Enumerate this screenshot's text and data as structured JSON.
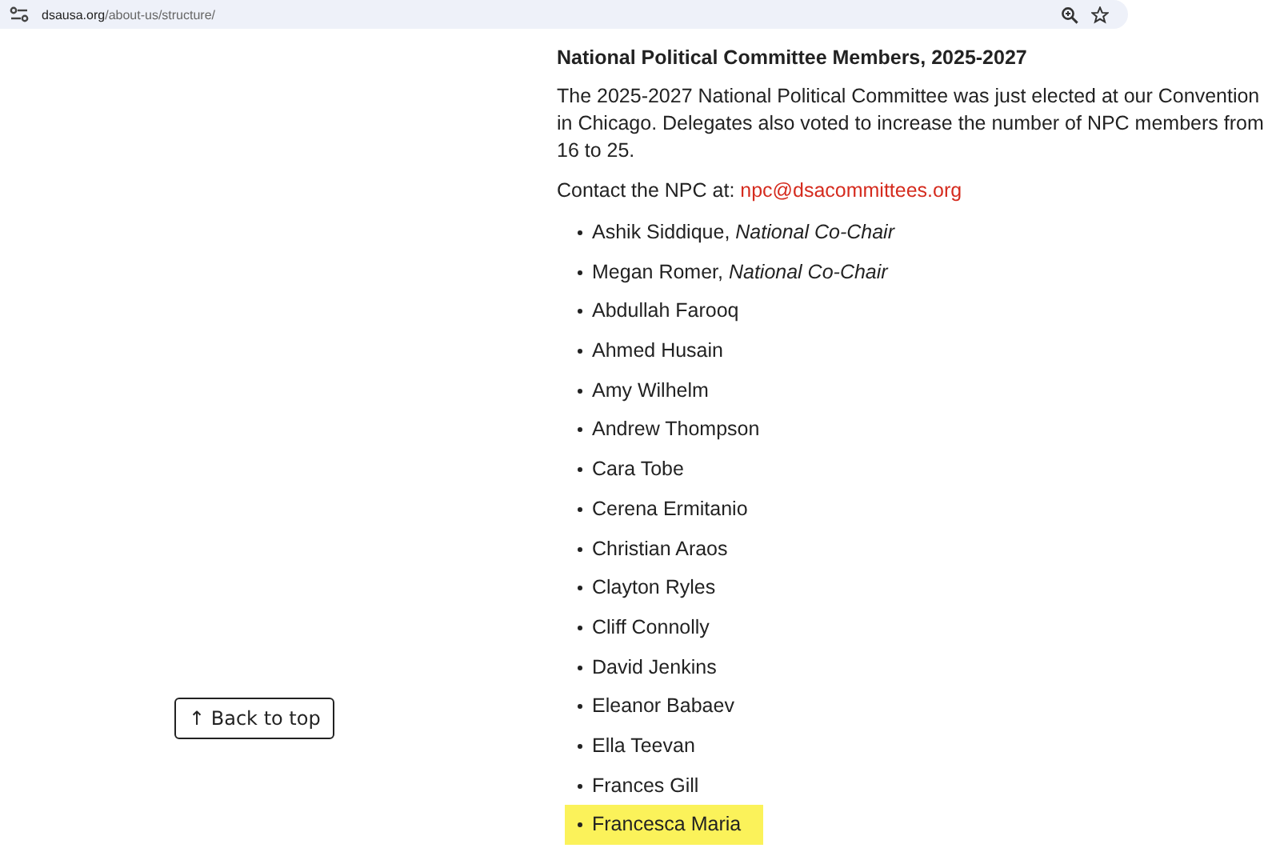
{
  "address_bar": {
    "domain": "dsausa.org",
    "path": "/about-us/structure/"
  },
  "back_to_top": {
    "arrow": "↑",
    "label": "Back to top"
  },
  "heading": "National Political Committee Members, 2025-2027",
  "intro": "The 2025-2027 National Political Committee was just elected at our Convention in Chicago. Delegates also voted to increase the number of NPC members from 16 to 25.",
  "contact": {
    "label": "Contact the NPC at:",
    "email": "npc@dsacommittees.org"
  },
  "members": [
    {
      "name": "Ashik Siddique, *National Co-Chair*",
      "highlighted": false
    },
    {
      "name": "Megan Romer, *National Co-Chair*",
      "highlighted": false
    },
    {
      "name": "Abdullah Farooq",
      "highlighted": false
    },
    {
      "name": "Ahmed Husain",
      "highlighted": false
    },
    {
      "name": "Amy Wilhelm",
      "highlighted": false
    },
    {
      "name": "Andrew Thompson",
      "highlighted": false
    },
    {
      "name": "Cara Tobe",
      "highlighted": false
    },
    {
      "name": "Cerena Ermitanio",
      "highlighted": false
    },
    {
      "name": "Christian Araos",
      "highlighted": false
    },
    {
      "name": "Clayton Ryles",
      "highlighted": false
    },
    {
      "name": "Cliff Connolly",
      "highlighted": false
    },
    {
      "name": "David Jenkins",
      "highlighted": false
    },
    {
      "name": "Eleanor Babaev",
      "highlighted": false
    },
    {
      "name": "Ella Teevan",
      "highlighted": false
    },
    {
      "name": "Frances Gill",
      "highlighted": false
    },
    {
      "name": "Francesca Maria",
      "highlighted": true
    }
  ]
}
